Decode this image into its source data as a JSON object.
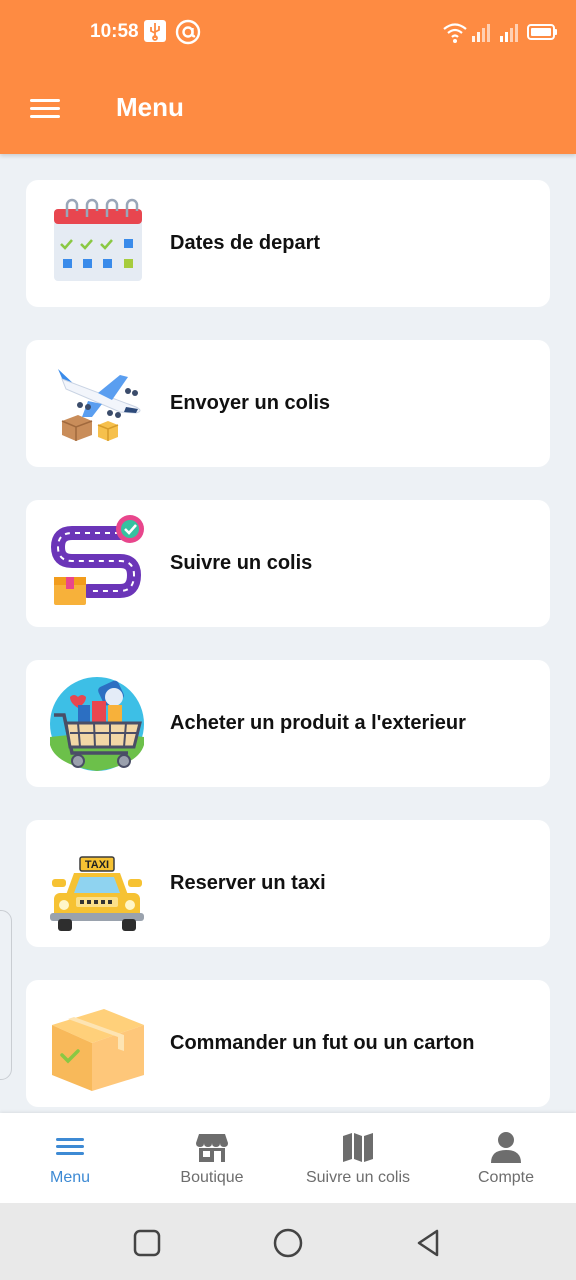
{
  "status_bar": {
    "time": "10:58",
    "icons": [
      "usb-icon",
      "at-sign-icon",
      "wifi-icon",
      "signal-icon",
      "signal-icon",
      "battery-icon"
    ]
  },
  "header": {
    "title": "Menu",
    "menu_icon": "hamburger-icon"
  },
  "menu_items": [
    {
      "label": "Dates de depart",
      "icon": "calendar-icon"
    },
    {
      "label": "Envoyer un colis",
      "icon": "airplane-parcels-icon"
    },
    {
      "label": "Suivre un colis",
      "icon": "tracking-route-icon"
    },
    {
      "label": "Acheter un produit a l'exterieur",
      "icon": "shopping-cart-globe-icon"
    },
    {
      "label": "Reserver un taxi",
      "icon": "taxi-icon"
    },
    {
      "label": "Commander un fut ou un carton",
      "icon": "cardboard-box-icon"
    }
  ],
  "bottom_nav": {
    "items": [
      {
        "label": "Menu",
        "icon": "menu-icon",
        "active": true
      },
      {
        "label": "Boutique",
        "icon": "store-icon",
        "active": false
      },
      {
        "label": "Suivre un colis",
        "icon": "map-icon",
        "active": false
      },
      {
        "label": "Compte",
        "icon": "user-icon",
        "active": false
      }
    ]
  },
  "colors": {
    "accent": "#fe8b42",
    "active_nav": "#3d8ad4",
    "background": "#edf1f5"
  }
}
